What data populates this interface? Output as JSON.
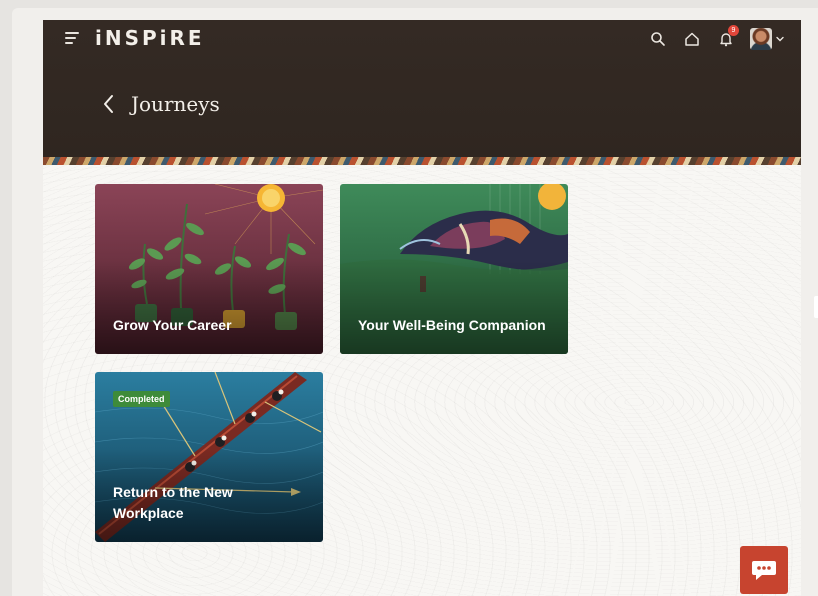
{
  "header": {
    "brand": "iNSPiRE",
    "page_title": "Journeys",
    "notification_count": "9",
    "icons": [
      "menu-icon",
      "search-icon",
      "home-icon",
      "bell-icon",
      "avatar",
      "chevron-down-icon",
      "back-icon"
    ]
  },
  "cards": [
    {
      "title": "Grow Your Career",
      "status": ""
    },
    {
      "title": "Your Well-Being Companion",
      "status": ""
    },
    {
      "title": "Return to the New Workplace",
      "status": "Completed"
    }
  ],
  "colors": {
    "header_bg": "#342a24",
    "card1": "#6e2f3c",
    "card2": "#2f6b43",
    "card3": "#1f5a74",
    "completed_badge": "#3e8b3a",
    "chat_button": "#c7442f"
  },
  "chat": {
    "icon": "chat-icon"
  }
}
